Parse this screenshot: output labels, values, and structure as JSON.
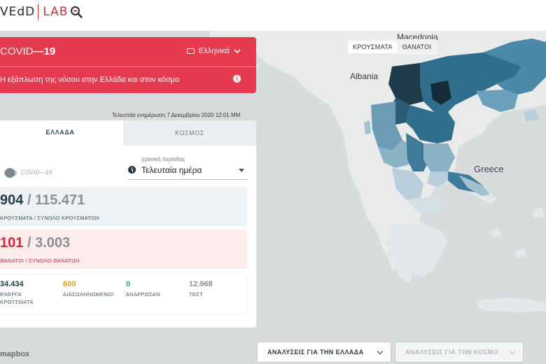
{
  "logo": {
    "brand": "VEdD",
    "lab": "LAB"
  },
  "map": {
    "labels": {
      "macedonia": "Macedonia",
      "albania": "Albania",
      "greece": "Greece"
    },
    "attribution": "mapbox",
    "metric_toggle": {
      "cases": "ΚΡΟΥΣΜΑΤΑ",
      "deaths": "ΘΑΝΑΤΟΙ",
      "selected": "cases"
    },
    "colors": {
      "sea": "#d9dcdc",
      "land": "#e9ebeb",
      "region_dark": "#1f3b4c",
      "region_mid": "#2f6e8d",
      "region_light": "#9ec2d2",
      "region_pale": "#d3e1e7"
    }
  },
  "header": {
    "title_prefix": "COVID",
    "title_suffix": "19",
    "language": "Ελληνικά",
    "subtitle": "Η εξάπλωση της νόσου στην Ελλάδα και στον κόσμο",
    "accent": "#e63a4e"
  },
  "updated": "Τελευταία ενημέρωση 7 Δεκεμβρίου 2020 12:01 ΜΜ",
  "tabs": {
    "greece": "ΕΛΛΑΔΑ",
    "world": "ΚΟΣΜΟΣ"
  },
  "controls": {
    "switch_label": "COVID—19",
    "period_label": "χρονική περίοδος",
    "period_value": "Τελευταία ημέρα"
  },
  "cases": {
    "value": "904",
    "total": "115.471",
    "caption": "ΚΡΟΥΣΜΑΤΑ / ΣΥΝΟΛΟ ΚΡΟΥΣΜΑΤΩΝ"
  },
  "deaths": {
    "value": "101",
    "total": "3.003",
    "caption": "ΘΑΝΑΤΟΙ / ΣΥΝΟΛΟ ΘΑΝΑΤΩΝ"
  },
  "stats": {
    "active": {
      "value": "34.434",
      "label_1": "ΕΝΕΡΓΑ",
      "label_2": "ΚΡΟΥΣΜΑΤΑ"
    },
    "intubated": {
      "value": "600",
      "label_1": "ΔΙΑΣΩΛΗΝΩΜΕΝΟΙ"
    },
    "recovered": {
      "value": "0",
      "label_1": "ΑΝΑΡΡΩΣΑΝ"
    },
    "tests": {
      "value": "12.968",
      "label_1": "ΤΕΣΤ"
    }
  },
  "buttons": {
    "analysis_greece": "ΑΝΑΛΥΣΕΙΣ ΓΙΑ ΤΗΝ ΕΛΛΑΔΑ",
    "analysis_world": "ΑΝΑΛΥΣΕΙΣ ΓΙΑ ΤΟΝ ΚΟΣΜΟ"
  }
}
